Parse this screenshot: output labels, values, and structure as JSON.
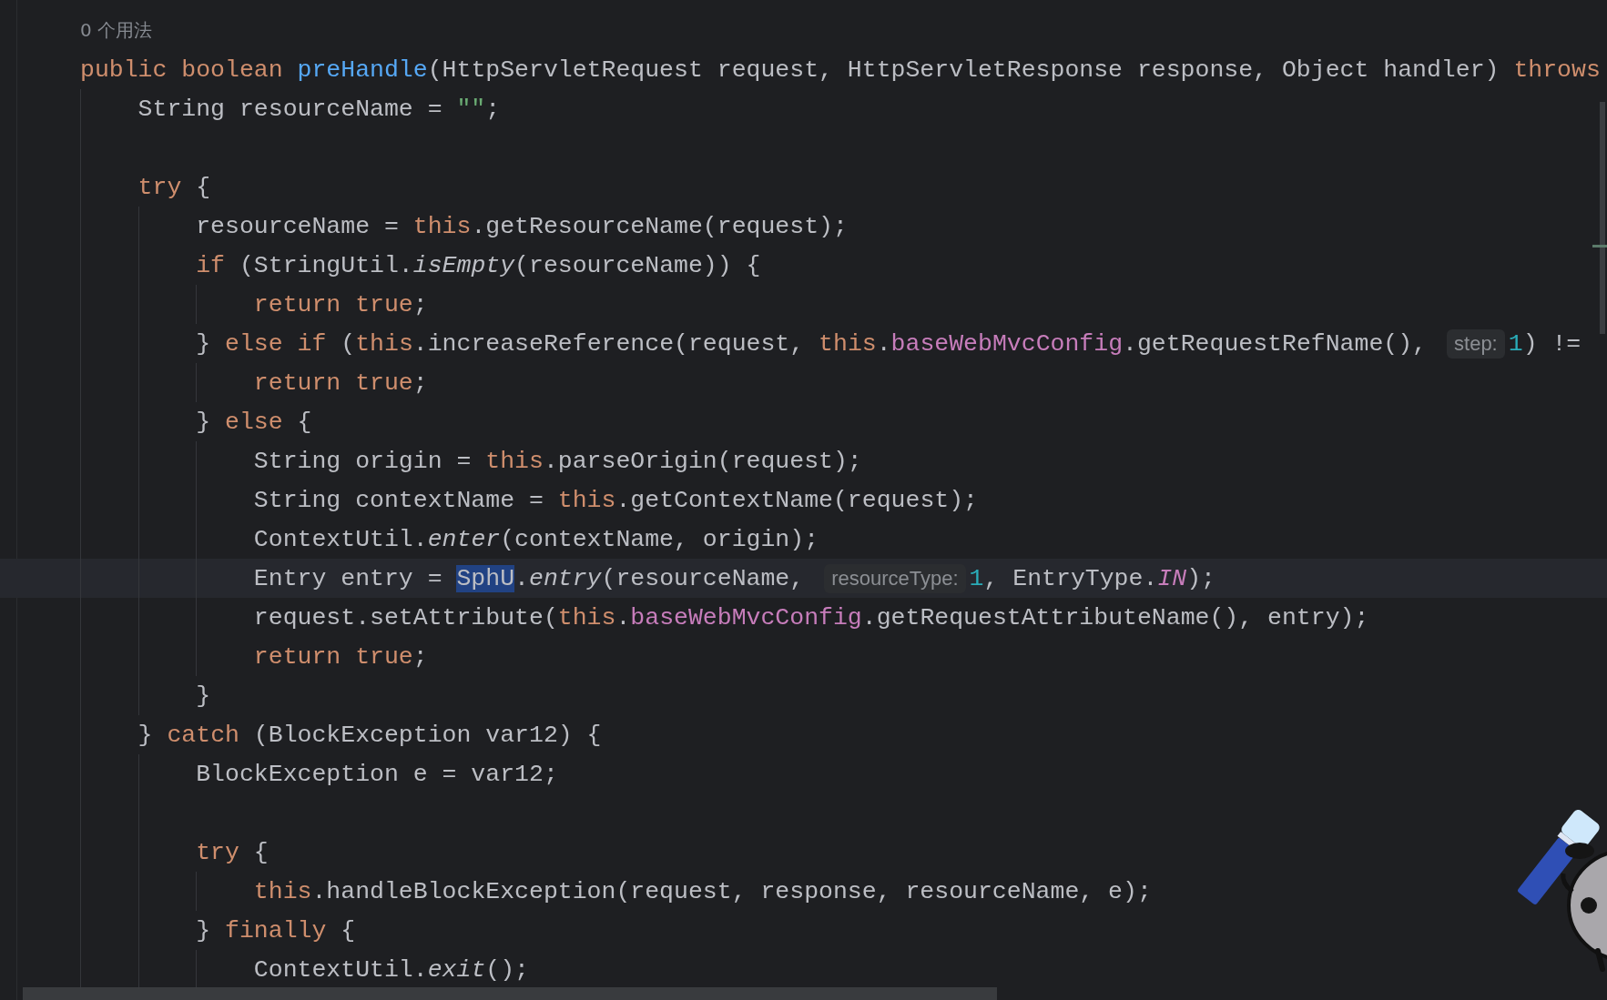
{
  "usage_hint": "0 个用法",
  "lines": [
    {
      "current": false,
      "segments": [
        {
          "kind": "code",
          "tokens": [
            {
              "kind": "kw",
              "text": "public boolean "
            },
            {
              "kind": "decl",
              "text": "preHandle"
            },
            {
              "kind": "plain",
              "text": "(HttpServletRequest request, HttpServletResponse response, Object handler) "
            },
            {
              "kind": "kw",
              "text": "throws"
            }
          ]
        }
      ]
    },
    {
      "current": false,
      "segments": [
        {
          "kind": "code",
          "tokens": [
            {
              "kind": "plain",
              "text": "    String resourceName = "
            },
            {
              "kind": "str",
              "text": "\"\""
            },
            {
              "kind": "plain",
              "text": ";"
            }
          ]
        }
      ]
    },
    {
      "current": false,
      "kind": "blank"
    },
    {
      "current": false,
      "segments": [
        {
          "kind": "code",
          "tokens": [
            {
              "kind": "kw",
              "text": "    try "
            },
            {
              "kind": "plain",
              "text": "{"
            }
          ]
        }
      ]
    },
    {
      "current": false,
      "segments": [
        {
          "kind": "code",
          "tokens": [
            {
              "kind": "plain",
              "text": "        resourceName = "
            },
            {
              "kind": "kw",
              "text": "this"
            },
            {
              "kind": "plain",
              "text": ".getResourceName(request);"
            }
          ]
        }
      ]
    },
    {
      "current": false,
      "segments": [
        {
          "kind": "code",
          "tokens": [
            {
              "kind": "kw",
              "text": "        if "
            },
            {
              "kind": "plain",
              "text": "(StringUtil."
            },
            {
              "kind": "italic",
              "text": "isEmpty"
            },
            {
              "kind": "plain",
              "text": "(resourceName)) {"
            }
          ]
        }
      ]
    },
    {
      "current": false,
      "segments": [
        {
          "kind": "code",
          "tokens": [
            {
              "kind": "kw",
              "text": "            return true"
            },
            {
              "kind": "plain",
              "text": ";"
            }
          ]
        }
      ]
    },
    {
      "current": false,
      "segments": [
        {
          "kind": "code",
          "tokens": [
            {
              "kind": "plain",
              "text": "        } "
            },
            {
              "kind": "kw",
              "text": "else if "
            },
            {
              "kind": "plain",
              "text": "("
            },
            {
              "kind": "kw",
              "text": "this"
            },
            {
              "kind": "plain",
              "text": ".increaseReference(request, "
            },
            {
              "kind": "kw",
              "text": "this"
            },
            {
              "kind": "plain",
              "text": "."
            },
            {
              "kind": "field",
              "text": "baseWebMvcConfig"
            },
            {
              "kind": "plain",
              "text": ".getRequestRefName(),"
            }
          ]
        },
        {
          "kind": "hint",
          "text": "step:"
        },
        {
          "kind": "code",
          "tokens": [
            {
              "kind": "num",
              "text": "1"
            },
            {
              "kind": "plain",
              "text": ") !="
            }
          ]
        }
      ]
    },
    {
      "current": false,
      "segments": [
        {
          "kind": "code",
          "tokens": [
            {
              "kind": "kw",
              "text": "            return true"
            },
            {
              "kind": "plain",
              "text": ";"
            }
          ]
        }
      ]
    },
    {
      "current": false,
      "segments": [
        {
          "kind": "code",
          "tokens": [
            {
              "kind": "plain",
              "text": "        } "
            },
            {
              "kind": "kw",
              "text": "else "
            },
            {
              "kind": "plain",
              "text": "{"
            }
          ]
        }
      ]
    },
    {
      "current": false,
      "segments": [
        {
          "kind": "code",
          "tokens": [
            {
              "kind": "plain",
              "text": "            String origin = "
            },
            {
              "kind": "kw",
              "text": "this"
            },
            {
              "kind": "plain",
              "text": ".parseOrigin(request);"
            }
          ]
        }
      ]
    },
    {
      "current": false,
      "segments": [
        {
          "kind": "code",
          "tokens": [
            {
              "kind": "plain",
              "text": "            String contextName = "
            },
            {
              "kind": "kw",
              "text": "this"
            },
            {
              "kind": "plain",
              "text": ".getContextName(request);"
            }
          ]
        }
      ]
    },
    {
      "current": false,
      "segments": [
        {
          "kind": "code",
          "tokens": [
            {
              "kind": "plain",
              "text": "            ContextUtil."
            },
            {
              "kind": "italic",
              "text": "enter"
            },
            {
              "kind": "plain",
              "text": "(contextName, origin);"
            }
          ]
        }
      ]
    },
    {
      "current": true,
      "segments": [
        {
          "kind": "code",
          "tokens": [
            {
              "kind": "plain",
              "text": "            Entry entry = "
            },
            {
              "kind": "sel",
              "text": "SphU"
            },
            {
              "kind": "plain",
              "text": "."
            },
            {
              "kind": "italic",
              "text": "entry"
            },
            {
              "kind": "plain",
              "text": "(resourceName,"
            }
          ]
        },
        {
          "kind": "hint",
          "text": "resourceType:"
        },
        {
          "kind": "code",
          "tokens": [
            {
              "kind": "num",
              "text": "1"
            },
            {
              "kind": "plain",
              "text": ", EntryType."
            },
            {
              "kind": "const",
              "text": "IN"
            },
            {
              "kind": "plain",
              "text": ");"
            }
          ]
        }
      ]
    },
    {
      "current": false,
      "segments": [
        {
          "kind": "code",
          "tokens": [
            {
              "kind": "plain",
              "text": "            request.setAttribute("
            },
            {
              "kind": "kw",
              "text": "this"
            },
            {
              "kind": "plain",
              "text": "."
            },
            {
              "kind": "field",
              "text": "baseWebMvcConfig"
            },
            {
              "kind": "plain",
              "text": ".getRequestAttributeName(), entry);"
            }
          ]
        }
      ]
    },
    {
      "current": false,
      "segments": [
        {
          "kind": "code",
          "tokens": [
            {
              "kind": "kw",
              "text": "            return true"
            },
            {
              "kind": "plain",
              "text": ";"
            }
          ]
        }
      ]
    },
    {
      "current": false,
      "segments": [
        {
          "kind": "code",
          "tokens": [
            {
              "kind": "plain",
              "text": "        }"
            }
          ]
        }
      ]
    },
    {
      "current": false,
      "segments": [
        {
          "kind": "code",
          "tokens": [
            {
              "kind": "plain",
              "text": "    } "
            },
            {
              "kind": "kw",
              "text": "catch "
            },
            {
              "kind": "plain",
              "text": "(BlockException var12) {"
            }
          ]
        }
      ]
    },
    {
      "current": false,
      "segments": [
        {
          "kind": "code",
          "tokens": [
            {
              "kind": "plain",
              "text": "        BlockException e = var12;"
            }
          ]
        }
      ]
    },
    {
      "current": false,
      "kind": "blank"
    },
    {
      "current": false,
      "segments": [
        {
          "kind": "code",
          "tokens": [
            {
              "kind": "kw",
              "text": "        try "
            },
            {
              "kind": "plain",
              "text": "{"
            }
          ]
        }
      ]
    },
    {
      "current": false,
      "segments": [
        {
          "kind": "code",
          "tokens": [
            {
              "kind": "kw",
              "text": "            this"
            },
            {
              "kind": "plain",
              "text": ".handleBlockException(request, response, resourceName, e);"
            }
          ]
        }
      ]
    },
    {
      "current": false,
      "segments": [
        {
          "kind": "code",
          "tokens": [
            {
              "kind": "plain",
              "text": "        } "
            },
            {
              "kind": "kw",
              "text": "finally "
            },
            {
              "kind": "plain",
              "text": "{"
            }
          ]
        }
      ]
    },
    {
      "current": false,
      "segments": [
        {
          "kind": "code",
          "tokens": [
            {
              "kind": "plain",
              "text": "            ContextUtil."
            },
            {
              "kind": "italic",
              "text": "exit"
            },
            {
              "kind": "plain",
              "text": "();"
            }
          ]
        }
      ]
    }
  ]
}
